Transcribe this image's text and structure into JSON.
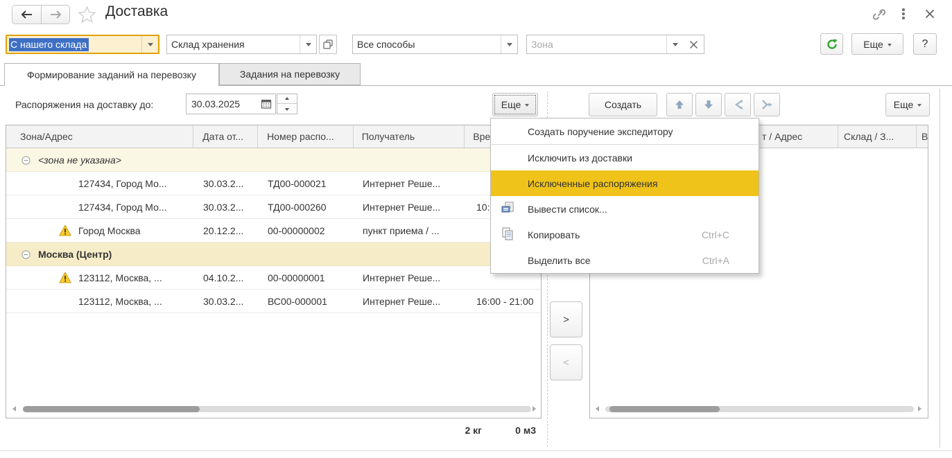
{
  "window": {
    "title": "Доставка"
  },
  "filters": {
    "delivery_type": {
      "value": "С нашего склада"
    },
    "warehouse": {
      "value": "Склад хранения"
    },
    "method": {
      "value": "Все способы"
    },
    "zone": {
      "placeholder": "Зона"
    }
  },
  "top_toolbar": {
    "more_label": "Еще",
    "help_label": "?"
  },
  "tabs": [
    {
      "label": "Формирование заданий на перевозку",
      "active": true
    },
    {
      "label": "Задания на перевозку",
      "active": false
    }
  ],
  "orders_panel": {
    "date_label": "Распоряжения на доставку до:",
    "date_value": "30.03.2025",
    "more_label": "Еще"
  },
  "tasks_panel": {
    "create_label": "Создать",
    "more_label": "Еще"
  },
  "left_table": {
    "columns": [
      "Зона/Адрес",
      "Дата от...",
      "Номер распо...",
      "Получатель",
      "Вре"
    ],
    "rows": [
      {
        "type": "group",
        "address": "<зона не указана>"
      },
      {
        "type": "data",
        "address": "127434, Город Мо...",
        "date": "30.03.2...",
        "number": "ТД00-000021",
        "recipient": "Интернет Реше...",
        "time": ""
      },
      {
        "type": "data",
        "address": "127434, Город Мо...",
        "date": "30.03.2...",
        "number": "ТД00-000260",
        "recipient": "Интернет Реше...",
        "time": "10:"
      },
      {
        "type": "data",
        "warning": true,
        "address": "Город Москва",
        "date": "20.12.2...",
        "number": "00-00000002",
        "recipient": "пункт приема / ...",
        "time": ""
      },
      {
        "type": "group",
        "address": "Москва (Центр)"
      },
      {
        "type": "data",
        "warning": true,
        "address": "123112, Москва, ...",
        "date": "04.10.2...",
        "number": "00-00000001",
        "recipient": "Интернет Реше...",
        "time": ""
      },
      {
        "type": "data",
        "address": "123112, Москва, ...",
        "date": "30.03.2...",
        "number": "ВС00-000001",
        "recipient": "Интернет Реше...",
        "time": "16:00 - 21:00"
      }
    ],
    "totals": {
      "weight": "2 кг",
      "volume": "0 м3"
    }
  },
  "right_table": {
    "col1_visible": "т / Адрес",
    "col2": "Склад / З...",
    "col3": "В"
  },
  "transfer": {
    "to_right": ">",
    "to_left": "<"
  },
  "context_menu": {
    "items": [
      {
        "label": "Создать поручение экспедитору"
      },
      {
        "label": "Исключить из доставки"
      },
      {
        "label": "Исключенные распоряжения"
      },
      {
        "label": "Вывести список..."
      },
      {
        "label": "Копировать",
        "shortcut": "Ctrl+C"
      },
      {
        "label": "Выделить все",
        "shortcut": "Ctrl+A"
      }
    ]
  }
}
